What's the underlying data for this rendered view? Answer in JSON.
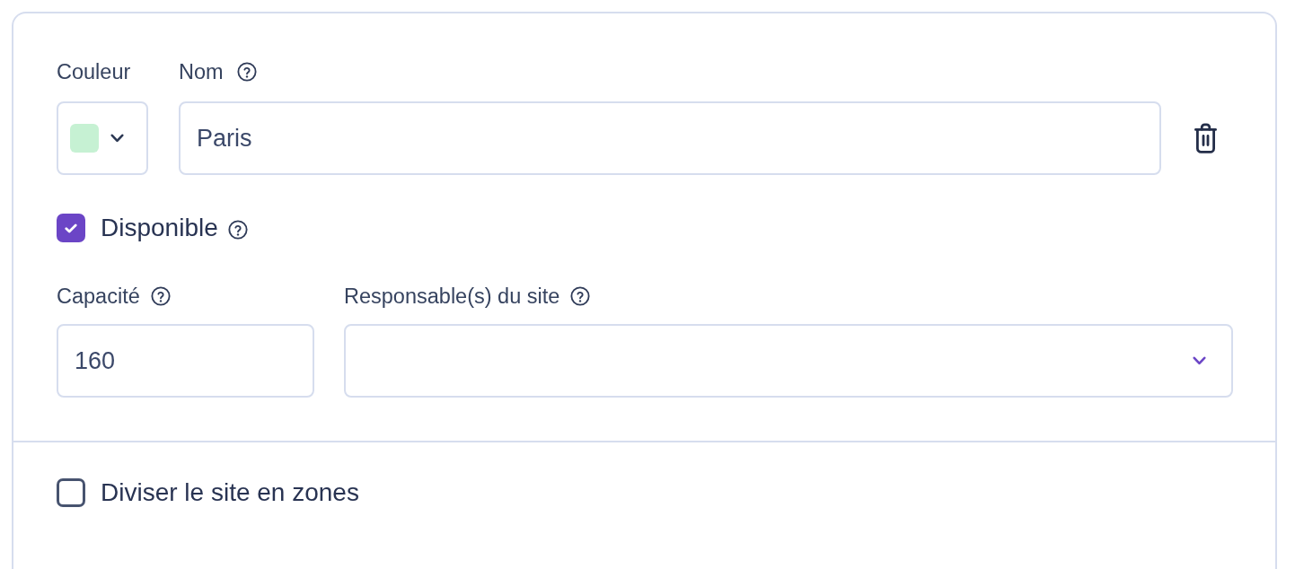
{
  "site_card": {
    "color_field": {
      "label": "Couleur",
      "color": "#c6f1d3"
    },
    "name_field": {
      "label": "Nom",
      "help": true,
      "value": "Paris"
    },
    "available": {
      "label": "Disponible",
      "help": true,
      "checked": true
    },
    "capacity_field": {
      "label": "Capacité",
      "help": true,
      "value": "160"
    },
    "managers_field": {
      "label": "Responsable(s) du site",
      "help": true
    },
    "split_zones": {
      "label": "Diviser le site en zones",
      "checked": false
    }
  }
}
